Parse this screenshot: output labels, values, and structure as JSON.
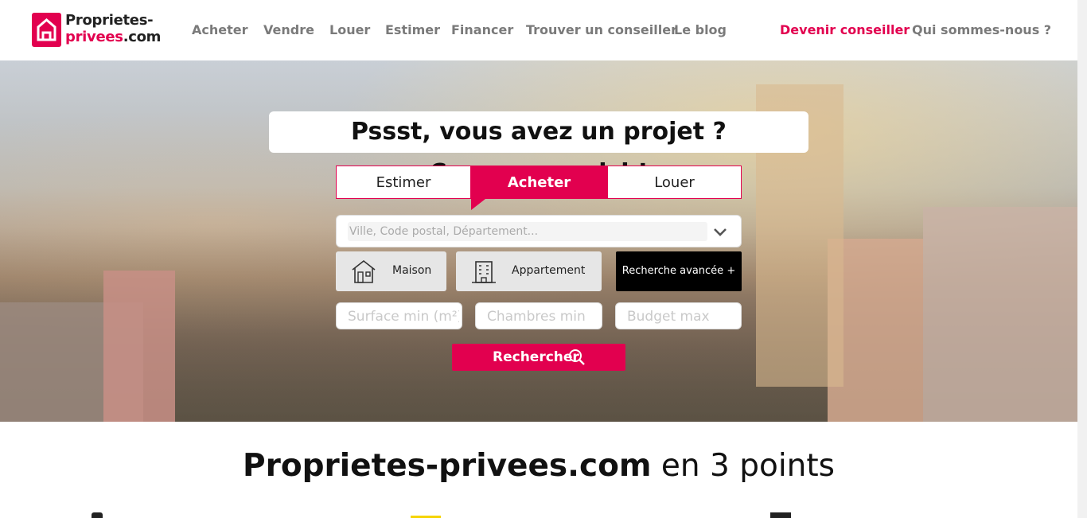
{
  "brand": {
    "line1": "Proprietes-",
    "line2_pink": "privees",
    "line2_dark": ".com",
    "accent": "#e2004f"
  },
  "nav": {
    "items": [
      "Acheter",
      "Vendre",
      "Louer",
      "Estimer",
      "Financer",
      "Trouver un conseiller",
      "Le blog"
    ],
    "devenir": "Devenir conseiller",
    "qui": "Qui sommes-nous ?"
  },
  "hero": {
    "tagline": "Pssst, vous avez un projet ? Commencez ici !",
    "tabs": [
      "Estimer",
      "Acheter",
      "Louer"
    ],
    "active_tab": "Acheter",
    "location_placeholder": "Ville, Code postal, Département...",
    "types": [
      "Maison",
      "Appartement"
    ],
    "advanced": "Recherche avancée +",
    "surface_placeholder": "Surface min (m²)",
    "chambres_placeholder": "Chambres min",
    "budget_placeholder": "Budget max",
    "search_label": "Rechercher"
  },
  "section": {
    "brand_bold": "Proprietes-privees.com",
    "rest": " en 3 points"
  },
  "icons": [
    "logo-house-icon",
    "chevron-down-icon",
    "house-icon",
    "building-icon",
    "search-icon"
  ]
}
